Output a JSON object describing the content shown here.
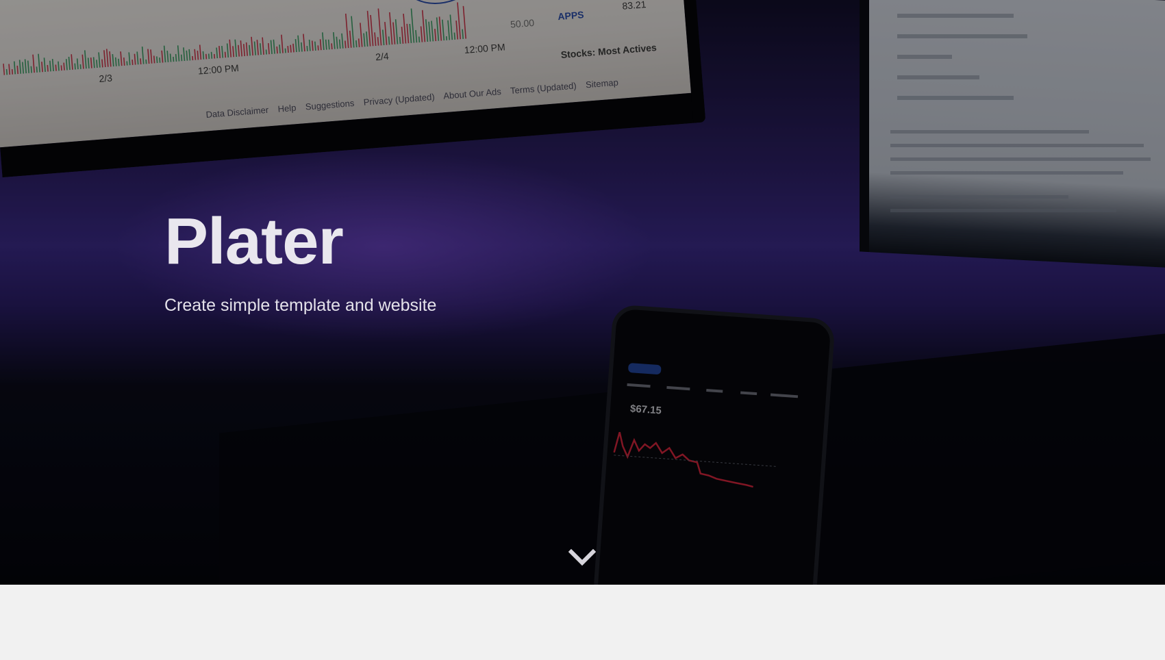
{
  "hero": {
    "title": "Plater",
    "subtitle": "Create simple template and website",
    "scroll_icon": "chevron-down-icon"
  },
  "background_photo": {
    "monitor_footer_links": [
      "Data Disclaimer",
      "Help",
      "Suggestions",
      "Privacy (Updated)",
      "About Our Ads",
      "Terms (Updated)",
      "Sitemap"
    ],
    "chart_labels": [
      "2/3",
      "12:00 PM",
      "2/4",
      "12:00 PM"
    ],
    "stocks_label": "Stocks: Most Actives",
    "ticker": "APPS",
    "ticker_price": "83.21",
    "level": "50.00",
    "phone_price": "$67.15"
  },
  "colors": {
    "overlay": "#000000",
    "accent_purple": "#3a2a86",
    "page_background": "#f1f1f1",
    "hero_text": "#e9e7ee"
  }
}
